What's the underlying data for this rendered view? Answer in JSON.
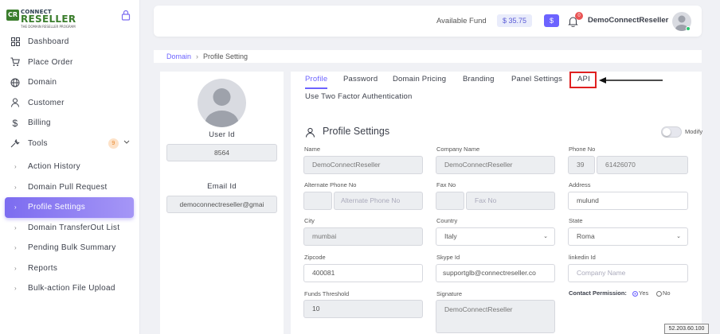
{
  "brand": {
    "line1": "CONNECT",
    "line2": "RESELLER",
    "tagline": "THE DOMAIN RESELLER PROGRAM",
    "mark": "CR"
  },
  "sidebar": {
    "items": [
      {
        "label": "Dashboard",
        "icon": "grid-icon"
      },
      {
        "label": "Place Order",
        "icon": "cart-icon"
      },
      {
        "label": "Domain",
        "icon": "globe-icon"
      },
      {
        "label": "Customer",
        "icon": "user-icon"
      },
      {
        "label": "Billing",
        "icon": "dollar-icon"
      },
      {
        "label": "Tools",
        "icon": "wrench-icon",
        "badge": "9"
      }
    ],
    "sub_items": [
      {
        "label": "Action History"
      },
      {
        "label": "Domain Pull Request"
      },
      {
        "label": "Profile Settings",
        "active": true
      },
      {
        "label": "Domain TransferOut List"
      },
      {
        "label": "Pending Bulk Summary"
      },
      {
        "label": "Reports"
      },
      {
        "label": "Bulk-action File Upload"
      }
    ]
  },
  "header": {
    "fund_label": "Available Fund",
    "fund_value": "$ 35.75",
    "dollar_button": "$",
    "notification_count": "0",
    "user_name": "DemoConnectReseller"
  },
  "breadcrumb": {
    "root": "Domain",
    "current": "Profile Setting"
  },
  "left_card": {
    "user_id_label": "User Id",
    "user_id_value": "8564",
    "email_label": "Email Id",
    "email_value": "democonnectreseller@gmai"
  },
  "tabs": [
    {
      "label": "Profile",
      "active": true
    },
    {
      "label": "Password"
    },
    {
      "label": "Domain Pricing"
    },
    {
      "label": "Branding"
    },
    {
      "label": "Panel Settings"
    },
    {
      "label": "API"
    },
    {
      "label": "Use Two Factor Authentication"
    }
  ],
  "profile": {
    "title": "Profile Settings",
    "modify_label": "Modify",
    "fields": {
      "name": {
        "label": "Name",
        "value": "DemoConnectReseller"
      },
      "company": {
        "label": "Company Name",
        "value": "DemoConnectReseller"
      },
      "phone": {
        "label": "Phone No",
        "code": "39",
        "value": "61426070"
      },
      "alt_phone": {
        "label": "Alternate Phone No",
        "placeholder": "Alternate Phone No"
      },
      "fax": {
        "label": "Fax No",
        "placeholder": "Fax No"
      },
      "address": {
        "label": "Address",
        "value": "mulund"
      },
      "city": {
        "label": "City",
        "value": "mumbai"
      },
      "country": {
        "label": "Country",
        "value": "Italy"
      },
      "state": {
        "label": "State",
        "value": "Roma"
      },
      "zipcode": {
        "label": "Zipcode",
        "value": "400081"
      },
      "skype": {
        "label": "Skype Id",
        "value": "supportglb@connectreseller.co"
      },
      "linkedin": {
        "label": "linkedin Id",
        "placeholder": "Company Name"
      },
      "funds": {
        "label": "Funds Threshold",
        "value": "10"
      },
      "signature": {
        "label": "Signature",
        "value": "DemoConnectReseller"
      },
      "contact_permission": {
        "label": "Contact Permission:",
        "yes": "Yes",
        "no": "No",
        "selected": "Yes"
      }
    }
  },
  "footer": {
    "ip": "52.203.60.100"
  },
  "colors": {
    "accent": "#6c63ff",
    "brand_green": "#3a7d2c",
    "highlight_red": "#e02020"
  }
}
